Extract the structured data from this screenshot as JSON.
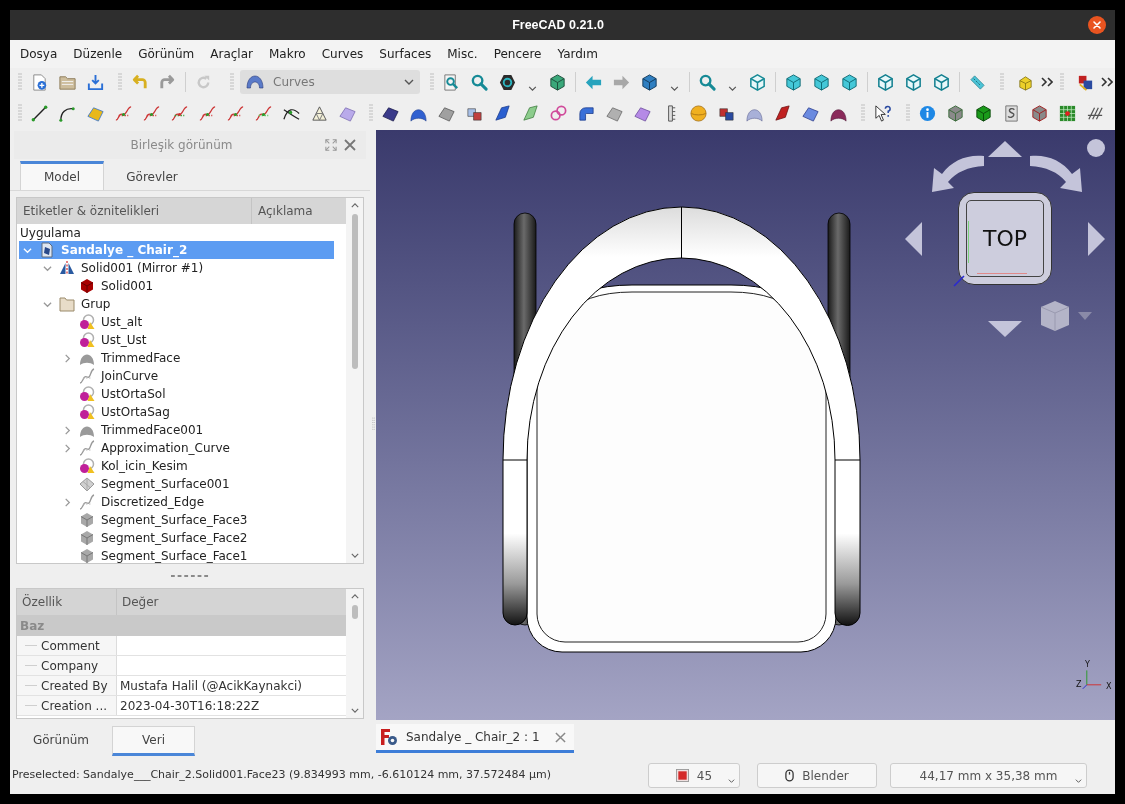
{
  "window": {
    "title": "FreeCAD 0.21.0"
  },
  "menu": [
    "Dosya",
    "Düzenle",
    "Görünüm",
    "Araçlar",
    "Makro",
    "Curves",
    "Surfaces",
    "Misc.",
    "Pencere",
    "Yardım"
  ],
  "toolbar": {
    "workbench": "Curves"
  },
  "combo_view": {
    "title": "Birleşik görünüm",
    "tabs": [
      {
        "label": "Model",
        "selected": true
      },
      {
        "label": "Görevler",
        "selected": false
      }
    ],
    "tree": {
      "columns": [
        "Etiketler & öznitelikleri",
        "Açıklama"
      ],
      "root_label": "Uygulama",
      "items": [
        {
          "label": "Sandalye _ Chair_2",
          "kind": "document",
          "selected": true,
          "expanded": true,
          "children": [
            {
              "label": "Solid001 (Mirror #1)",
              "kind": "mirror",
              "selected": false,
              "expanded": true,
              "children": [
                {
                  "label": "Solid001",
                  "kind": "solid",
                  "selected": false
                }
              ]
            },
            {
              "label": "Grup",
              "kind": "folder",
              "selected": false,
              "expanded": true,
              "children": [
                {
                  "label": "Ust_alt",
                  "kind": "sketch",
                  "selected": false
                },
                {
                  "label": "Ust_Ust",
                  "kind": "sketch",
                  "selected": false
                },
                {
                  "label": "TrimmedFace",
                  "kind": "trimmed_face",
                  "selected": false,
                  "expanded": false
                },
                {
                  "label": "JoinCurve",
                  "kind": "curve",
                  "selected": false
                },
                {
                  "label": "UstOrtaSol",
                  "kind": "sketch",
                  "selected": false
                },
                {
                  "label": "UstOrtaSag",
                  "kind": "sketch",
                  "selected": false
                },
                {
                  "label": "TrimmedFace001",
                  "kind": "trimmed_face",
                  "selected": false,
                  "expanded": false
                },
                {
                  "label": "Approximation_Curve",
                  "kind": "curve",
                  "selected": false,
                  "expanded": false
                },
                {
                  "label": "Kol_icin_Kesim",
                  "kind": "sketch",
                  "selected": false
                },
                {
                  "label": "Segment_Surface001",
                  "kind": "segment_surface",
                  "selected": false
                },
                {
                  "label": "Discretized_Edge",
                  "kind": "curve",
                  "selected": false,
                  "expanded": false
                },
                {
                  "label": "Segment_Surface_Face3",
                  "kind": "face",
                  "selected": false
                },
                {
                  "label": "Segment_Surface_Face2",
                  "kind": "face",
                  "selected": false
                },
                {
                  "label": "Segment_Surface_Face1",
                  "kind": "face",
                  "selected": false
                }
              ]
            }
          ]
        }
      ]
    },
    "properties": {
      "columns": [
        "Özellik",
        "Değer"
      ],
      "groups": [
        {
          "name": "Baz",
          "rows": [
            {
              "name": "Comment"
            },
            {
              "name": "Company"
            },
            {
              "name": "Created By",
              "value": "Mustafa Halil (@AcikKaynakci)"
            },
            {
              "name": "Creation ...",
              "value": "2023-04-30T16:18:22Z"
            }
          ]
        }
      ]
    },
    "bottom_tabs": [
      {
        "label": "Görünüm",
        "selected": false
      },
      {
        "label": "Veri",
        "selected": true
      }
    ]
  },
  "viewport": {
    "nav_cube": {
      "face": "TOP"
    },
    "axes": [
      "Y",
      "Z",
      "X"
    ]
  },
  "document_tabs": [
    {
      "label": "Sandalye _ Chair_2 : 1",
      "selected": true
    }
  ],
  "status_bar": {
    "message": "Preselected: Sandalye___Chair_2.Solid001.Face23 (9.834993 mm, -6.610124 mm, 37.572484 µm)",
    "controls": [
      {
        "kind": "draw_style",
        "label": "45"
      },
      {
        "kind": "navigation",
        "label": "Blender"
      },
      {
        "kind": "dimensions",
        "label": "44,17 mm x 35,38 mm"
      }
    ]
  }
}
